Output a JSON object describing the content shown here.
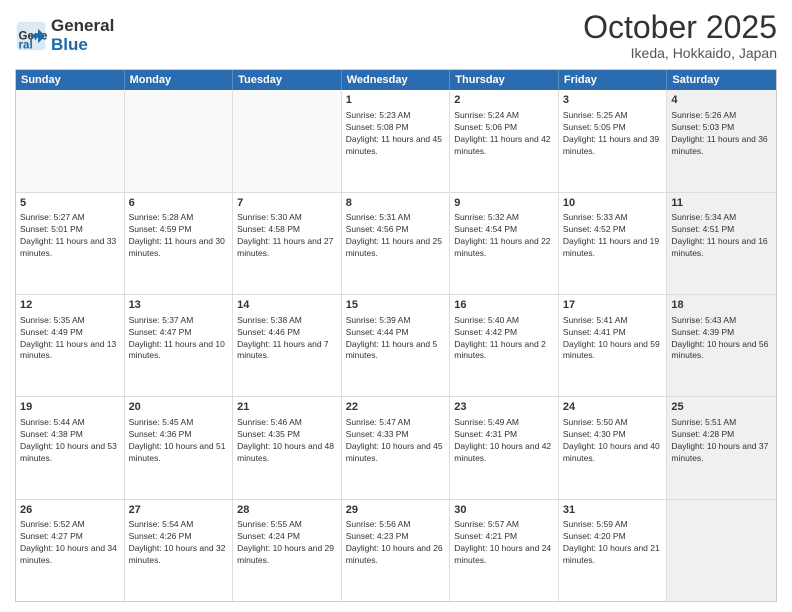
{
  "header": {
    "logo_general": "General",
    "logo_blue": "Blue",
    "month": "October 2025",
    "location": "Ikeda, Hokkaido, Japan"
  },
  "days_of_week": [
    "Sunday",
    "Monday",
    "Tuesday",
    "Wednesday",
    "Thursday",
    "Friday",
    "Saturday"
  ],
  "rows": [
    [
      {
        "day": "",
        "empty": true
      },
      {
        "day": "",
        "empty": true
      },
      {
        "day": "",
        "empty": true
      },
      {
        "day": "1",
        "sunrise": "5:23 AM",
        "sunset": "5:08 PM",
        "daylight": "11 hours and 45 minutes."
      },
      {
        "day": "2",
        "sunrise": "5:24 AM",
        "sunset": "5:06 PM",
        "daylight": "11 hours and 42 minutes."
      },
      {
        "day": "3",
        "sunrise": "5:25 AM",
        "sunset": "5:05 PM",
        "daylight": "11 hours and 39 minutes."
      },
      {
        "day": "4",
        "sunrise": "5:26 AM",
        "sunset": "5:03 PM",
        "daylight": "11 hours and 36 minutes.",
        "shaded": true
      }
    ],
    [
      {
        "day": "5",
        "sunrise": "5:27 AM",
        "sunset": "5:01 PM",
        "daylight": "11 hours and 33 minutes."
      },
      {
        "day": "6",
        "sunrise": "5:28 AM",
        "sunset": "4:59 PM",
        "daylight": "11 hours and 30 minutes."
      },
      {
        "day": "7",
        "sunrise": "5:30 AM",
        "sunset": "4:58 PM",
        "daylight": "11 hours and 27 minutes."
      },
      {
        "day": "8",
        "sunrise": "5:31 AM",
        "sunset": "4:56 PM",
        "daylight": "11 hours and 25 minutes."
      },
      {
        "day": "9",
        "sunrise": "5:32 AM",
        "sunset": "4:54 PM",
        "daylight": "11 hours and 22 minutes."
      },
      {
        "day": "10",
        "sunrise": "5:33 AM",
        "sunset": "4:52 PM",
        "daylight": "11 hours and 19 minutes."
      },
      {
        "day": "11",
        "sunrise": "5:34 AM",
        "sunset": "4:51 PM",
        "daylight": "11 hours and 16 minutes.",
        "shaded": true
      }
    ],
    [
      {
        "day": "12",
        "sunrise": "5:35 AM",
        "sunset": "4:49 PM",
        "daylight": "11 hours and 13 minutes."
      },
      {
        "day": "13",
        "sunrise": "5:37 AM",
        "sunset": "4:47 PM",
        "daylight": "11 hours and 10 minutes."
      },
      {
        "day": "14",
        "sunrise": "5:38 AM",
        "sunset": "4:46 PM",
        "daylight": "11 hours and 7 minutes."
      },
      {
        "day": "15",
        "sunrise": "5:39 AM",
        "sunset": "4:44 PM",
        "daylight": "11 hours and 5 minutes."
      },
      {
        "day": "16",
        "sunrise": "5:40 AM",
        "sunset": "4:42 PM",
        "daylight": "11 hours and 2 minutes."
      },
      {
        "day": "17",
        "sunrise": "5:41 AM",
        "sunset": "4:41 PM",
        "daylight": "10 hours and 59 minutes."
      },
      {
        "day": "18",
        "sunrise": "5:43 AM",
        "sunset": "4:39 PM",
        "daylight": "10 hours and 56 minutes.",
        "shaded": true
      }
    ],
    [
      {
        "day": "19",
        "sunrise": "5:44 AM",
        "sunset": "4:38 PM",
        "daylight": "10 hours and 53 minutes."
      },
      {
        "day": "20",
        "sunrise": "5:45 AM",
        "sunset": "4:36 PM",
        "daylight": "10 hours and 51 minutes."
      },
      {
        "day": "21",
        "sunrise": "5:46 AM",
        "sunset": "4:35 PM",
        "daylight": "10 hours and 48 minutes."
      },
      {
        "day": "22",
        "sunrise": "5:47 AM",
        "sunset": "4:33 PM",
        "daylight": "10 hours and 45 minutes."
      },
      {
        "day": "23",
        "sunrise": "5:49 AM",
        "sunset": "4:31 PM",
        "daylight": "10 hours and 42 minutes."
      },
      {
        "day": "24",
        "sunrise": "5:50 AM",
        "sunset": "4:30 PM",
        "daylight": "10 hours and 40 minutes."
      },
      {
        "day": "25",
        "sunrise": "5:51 AM",
        "sunset": "4:28 PM",
        "daylight": "10 hours and 37 minutes.",
        "shaded": true
      }
    ],
    [
      {
        "day": "26",
        "sunrise": "5:52 AM",
        "sunset": "4:27 PM",
        "daylight": "10 hours and 34 minutes."
      },
      {
        "day": "27",
        "sunrise": "5:54 AM",
        "sunset": "4:26 PM",
        "daylight": "10 hours and 32 minutes."
      },
      {
        "day": "28",
        "sunrise": "5:55 AM",
        "sunset": "4:24 PM",
        "daylight": "10 hours and 29 minutes."
      },
      {
        "day": "29",
        "sunrise": "5:56 AM",
        "sunset": "4:23 PM",
        "daylight": "10 hours and 26 minutes."
      },
      {
        "day": "30",
        "sunrise": "5:57 AM",
        "sunset": "4:21 PM",
        "daylight": "10 hours and 24 minutes."
      },
      {
        "day": "31",
        "sunrise": "5:59 AM",
        "sunset": "4:20 PM",
        "daylight": "10 hours and 21 minutes."
      },
      {
        "day": "",
        "empty": true,
        "shaded": true
      }
    ]
  ]
}
